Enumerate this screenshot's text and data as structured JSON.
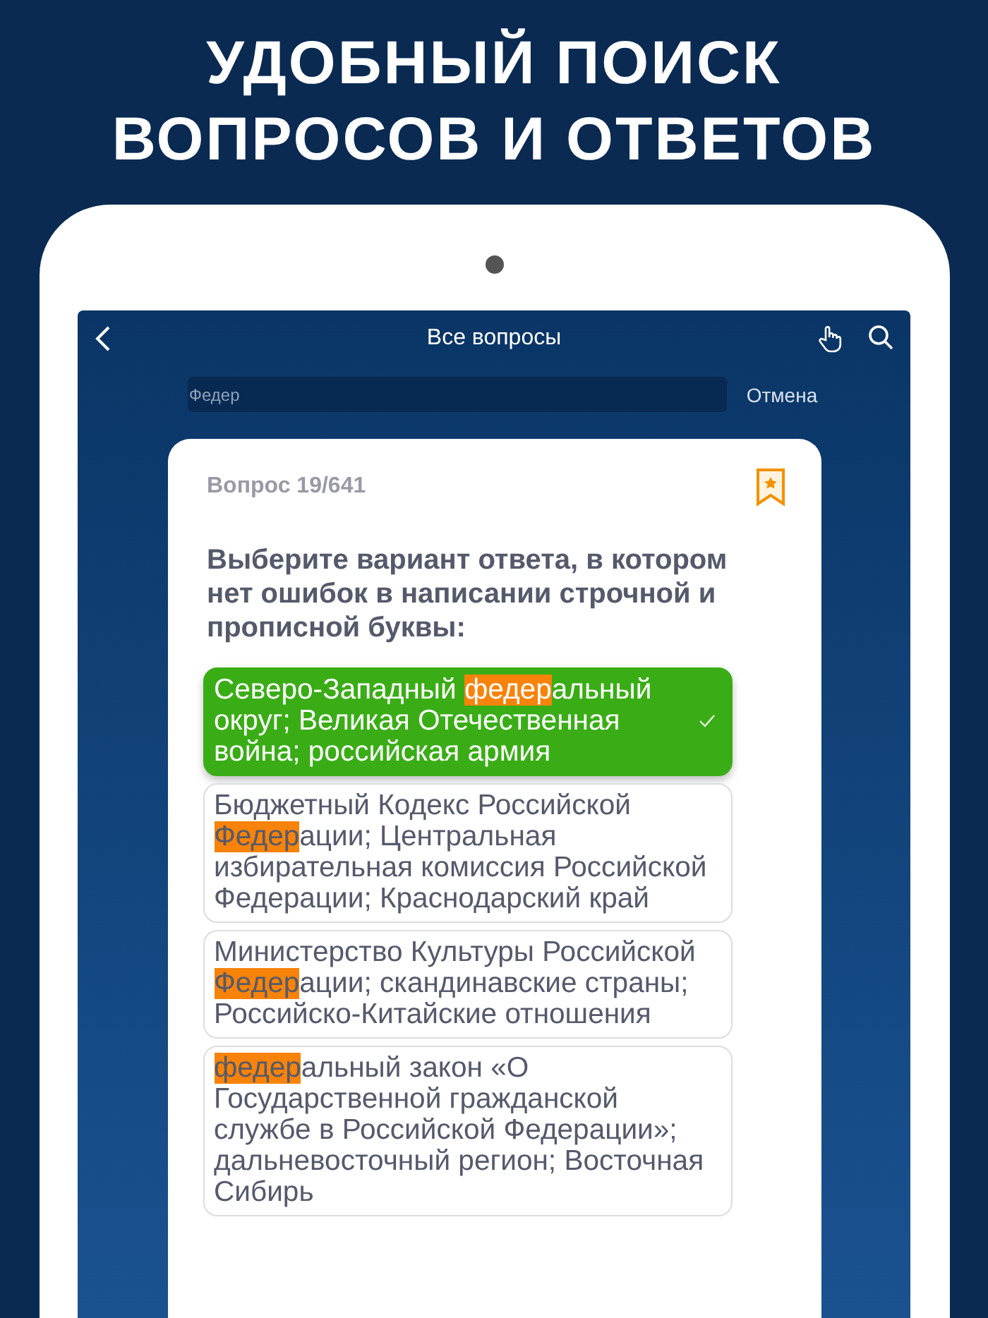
{
  "headline_lines": [
    "УДОБНЫЙ ПОИСК",
    "ВОПРОСОВ И ОТВЕТОВ"
  ],
  "nav": {
    "title": "Все вопросы"
  },
  "search": {
    "value": "Федер",
    "cancel": "Отмена"
  },
  "card": {
    "counter": "Вопрос 19/641",
    "bookmarked": true,
    "question": "Выберите вариант ответа, в котором нет ошибок в написании строчной и прописной буквы:"
  },
  "answers": [
    {
      "selected": true,
      "segments": [
        {
          "text": "Северо-Западный ",
          "highlight": false
        },
        {
          "text": "федер",
          "highlight": true
        },
        {
          "text": "альный округ; Великая Отечественная война; российская армия",
          "highlight": false
        }
      ]
    },
    {
      "selected": false,
      "segments": [
        {
          "text": "Бюджетный Кодекс Российской ",
          "highlight": false
        },
        {
          "text": "Федер",
          "highlight": true
        },
        {
          "text": "ации; Центральная избирательная комиссия Российской Федерации; Краснодарский край",
          "highlight": false
        }
      ]
    },
    {
      "selected": false,
      "segments": [
        {
          "text": "Министерство Культуры Российской ",
          "highlight": false
        },
        {
          "text": "Федер",
          "highlight": true
        },
        {
          "text": "ации; скандинавские страны; Российско-Китайские отношения",
          "highlight": false
        }
      ]
    },
    {
      "selected": false,
      "segments": [
        {
          "text": "федер",
          "highlight": true
        },
        {
          "text": "альный закон «О Государственной гражданской службе в Российской Федерации»; дальневосточный регион; Восточная Сибирь",
          "highlight": false
        }
      ]
    }
  ]
}
